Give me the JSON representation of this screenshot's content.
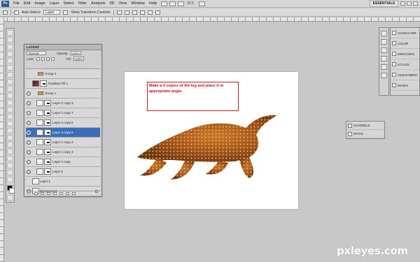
{
  "app": {
    "logo_text": "Ps",
    "zoom": "25.5",
    "workspace": "ESSENTIALS"
  },
  "menu": [
    "File",
    "Edit",
    "Image",
    "Layer",
    "Select",
    "Filter",
    "Analysis",
    "3D",
    "View",
    "Window",
    "Help"
  ],
  "options_bar": {
    "auto_select_label": "Auto-Select:",
    "auto_select_value": "Layer",
    "show_transform_label": "Show Transform Controls"
  },
  "canvas": {
    "instruction_text": "Make a 3 copies of the leg and place it in appropriate angle."
  },
  "layers_panel": {
    "tab_label": "LAYERS",
    "blend_mode": "Normal",
    "opacity_label": "Opacity:",
    "opacity_value": "100%",
    "lock_label": "Lock:",
    "fill_label": "Fill:",
    "fill_value": "100%",
    "layers": [
      {
        "name": "Group 4",
        "kind": "group"
      },
      {
        "name": "Gradient Fill 1",
        "kind": "gradient"
      },
      {
        "name": "Group 1",
        "kind": "group-open"
      },
      {
        "name": "Layer 2 copy 3",
        "kind": "masked"
      },
      {
        "name": "Layer 2 copy 7",
        "kind": "masked"
      },
      {
        "name": "Layer 2 copy 6",
        "kind": "masked"
      },
      {
        "name": "Layer 2 copy 5",
        "kind": "masked",
        "selected": true
      },
      {
        "name": "Layer 2 copy 4",
        "kind": "masked"
      },
      {
        "name": "Layer 2 copy 2",
        "kind": "masked"
      },
      {
        "name": "Layer 2 copy",
        "kind": "masked"
      },
      {
        "name": "Layer 2",
        "kind": "masked"
      },
      {
        "name": "Layer 1",
        "kind": "plain"
      },
      {
        "name": "Background",
        "kind": "background"
      }
    ]
  },
  "right_panels": {
    "top": [
      "CHARACTER",
      "COLOR",
      "SWATCHES",
      "STYLES",
      "ADJUSTMENT",
      "MASKS"
    ],
    "middle": [
      "CHANNELS",
      "PATHS"
    ]
  },
  "watermark": "pxleyes.com",
  "colors": {
    "selected_layer": "#3c6db8",
    "instruction_red": "#c8101d",
    "workspace_bg": "#c8c8c8"
  }
}
